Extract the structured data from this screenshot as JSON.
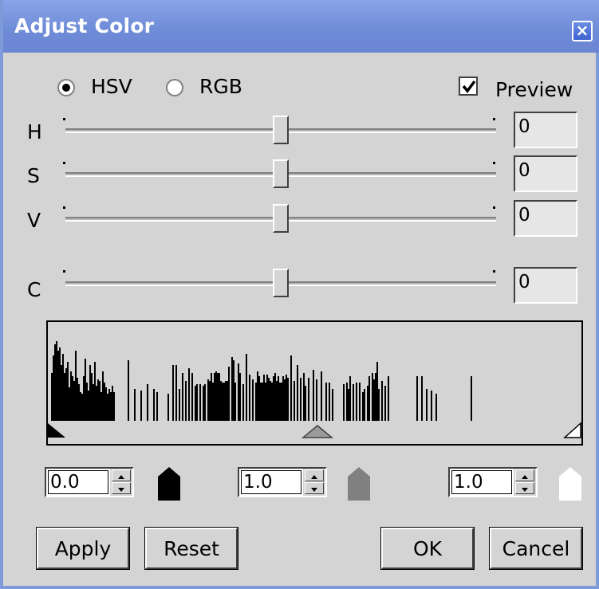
{
  "window": {
    "title": "Adjust Color",
    "close_glyph": "×",
    "titlebar_color": "#7b97e0"
  },
  "mode": {
    "hsv_label": "HSV",
    "rgb_label": "RGB",
    "selected": "HSV",
    "preview_label": "Preview",
    "preview_checked": true
  },
  "sliders": [
    {
      "label": "H",
      "value": "0",
      "position": 0.5
    },
    {
      "label": "S",
      "value": "0",
      "position": 0.5
    },
    {
      "label": "V",
      "value": "0",
      "position": 0.5
    },
    {
      "label": "C",
      "value": "0",
      "position": 0.5
    }
  ],
  "levels": {
    "black": {
      "value": "0.0",
      "color": "#000000"
    },
    "gray": {
      "value": "1.0",
      "color": "#808080"
    },
    "white": {
      "value": "1.0",
      "color": "#ffffff"
    }
  },
  "buttons": {
    "apply": "Apply",
    "reset": "Reset",
    "ok": "OK",
    "cancel": "Cancel"
  }
}
